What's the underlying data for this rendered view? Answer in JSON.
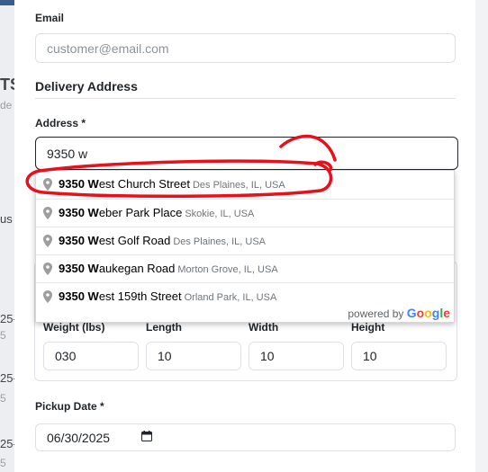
{
  "email": {
    "label": "Email",
    "placeholder": "customer@email.com"
  },
  "delivery": {
    "section_title": "Delivery Address",
    "address_label": "Address *",
    "address_value": "9350 w"
  },
  "autocomplete": {
    "items": [
      {
        "bold_prefix": "9350 W",
        "rest": "est Church Street",
        "secondary": "Des Plaines, IL, USA"
      },
      {
        "bold_prefix": "9350 W",
        "rest": "eber Park Place",
        "secondary": "Skokie, IL, USA"
      },
      {
        "bold_prefix": "9350 W",
        "rest": "est Golf Road",
        "secondary": "Des Plaines, IL, USA"
      },
      {
        "bold_prefix": "9350 W",
        "rest": "aukegan Road",
        "secondary": "Morton Grove, IL, USA"
      },
      {
        "bold_prefix": "9350 W",
        "rest": "est 159th Street",
        "secondary": "Orland Park, IL, USA"
      }
    ],
    "powered_by": "powered by",
    "google_letters": [
      "G",
      "o",
      "o",
      "g",
      "l",
      "e"
    ],
    "google_colors": [
      "#4285F4",
      "#EA4335",
      "#FBBC05",
      "#4285F4",
      "#34A853",
      "#EA4335"
    ]
  },
  "package": {
    "weight_label": "Weight (lbs)",
    "weight_value": "030",
    "length_label": "Length",
    "length_value": "10",
    "width_label": "Width",
    "width_value": "10",
    "height_label": "Height",
    "height_value": "10"
  },
  "pickup": {
    "label": "Pickup Date *",
    "value": "06/30/2025"
  },
  "background_fragments": {
    "a": "TS",
    "b": "de",
    "c": "us",
    "d": "25-",
    "e": "5",
    "f": "25-",
    "g": "5",
    "h": "25-",
    "i": "5"
  },
  "colors": {
    "annotation_red": "#e8101a",
    "pin_gray": "#9e9e9e"
  },
  "icons": {
    "pin": "map-pin-icon",
    "calendar": "calendar-icon"
  }
}
